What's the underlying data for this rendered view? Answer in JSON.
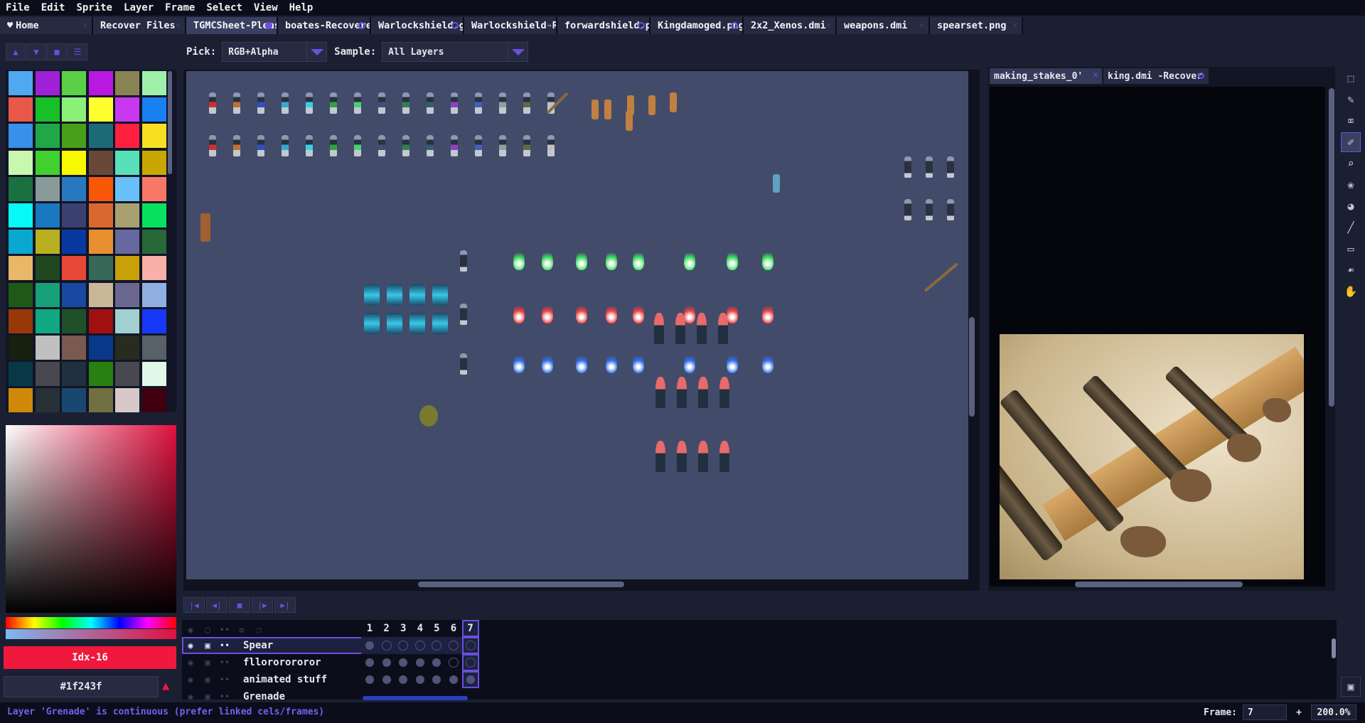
{
  "menu": [
    "File",
    "Edit",
    "Sprite",
    "Layer",
    "Frame",
    "Select",
    "View",
    "Help"
  ],
  "tabs": [
    {
      "label": "Home",
      "state": "close"
    },
    {
      "label": "Recover Files",
      "state": "close"
    },
    {
      "label": "TGMCSheet-Pleas",
      "state": "modified-active"
    },
    {
      "label": "boates-Recoverec",
      "state": "modified"
    },
    {
      "label": "Warlockshield.gif",
      "state": "modified"
    },
    {
      "label": "Warlockshield-Re",
      "state": "close"
    },
    {
      "label": "forwardshield.pn",
      "state": "modified"
    },
    {
      "label": "Kingdamoged.png",
      "state": "modified"
    },
    {
      "label": "2x2_Xenos.dmi",
      "state": "close"
    },
    {
      "label": "weapons.dmi",
      "state": "close"
    },
    {
      "label": "spearset.png",
      "state": "close"
    }
  ],
  "toolbar": {
    "pick_label": "Pick:",
    "pick_value": "RGB+Alpha",
    "sample_label": "Sample:",
    "sample_value": "All Layers"
  },
  "palette": {
    "colors": [
      "#4fa8f0",
      "#a020d8",
      "#5ad048",
      "#b818e0",
      "#8a8454",
      "#9ff0a8",
      "#e85848",
      "#18c028",
      "#8af078",
      "#ffff30",
      "#c838f0",
      "#1880f0",
      "#3890e8",
      "#20a848",
      "#48a018",
      "#1c6a78",
      "#ff2040",
      "#f8e020",
      "#c8f8b0",
      "#40d030",
      "#f8f800",
      "#6a4838",
      "#58e0b8",
      "#c8a800",
      "#1a7040",
      "#8a9a98",
      "#2878c0",
      "#f85808",
      "#68c0f8",
      "#f87868",
      "#08f8f8",
      "#1878c0",
      "#3a4070",
      "#d86830",
      "#a8a070",
      "#08e060",
      "#08a8d0",
      "#b8b020",
      "#0838a0",
      "#e89030",
      "#6868a0",
      "#286838",
      "#e8b868",
      "#204820",
      "#e84838",
      "#386858",
      "#c8a008",
      "#f8b0a8",
      "#205818",
      "#18a078",
      "#1848a0",
      "#c8b898",
      "#6a6890",
      "#90b0e0",
      "#983808",
      "#10a880",
      "#205028",
      "#a01010",
      "#a0d0d0",
      "#1838f8",
      "#182010",
      "#c0c0c0",
      "#7a5a50",
      "#083888",
      "#282c20",
      "#586068",
      "#083848",
      "#484850",
      "#203040",
      "#288010",
      "#484850",
      "#e0f8e8",
      "#d08808",
      "#283038",
      "#184870",
      "#707040",
      "#d8c8c8",
      "#400010"
    ]
  },
  "color": {
    "index_label": "Idx-16",
    "hex_value": "#1f243f",
    "picker_color": "#e0103e"
  },
  "reference_tabs": [
    {
      "label": "making_stakes_0'",
      "state": "close-active"
    },
    {
      "label": "king.dmi -Recover",
      "state": "modified"
    }
  ],
  "tools": [
    "rectangular-marquee-icon",
    "pencil-icon",
    "eraser-icon",
    "eyedropper-icon",
    "zoom-icon",
    "spray-icon",
    "paint-bucket-icon",
    "line-icon",
    "rectangle-icon",
    "blur-icon",
    "jumble-icon"
  ],
  "timeline": {
    "frames": [
      "1",
      "2",
      "3",
      "4",
      "5",
      "6",
      "7"
    ],
    "selected_frame": "7",
    "layers": [
      {
        "name": "Spear",
        "selected": true,
        "cels": [
          "full",
          "empty",
          "empty",
          "empty",
          "empty",
          "empty",
          "empty"
        ]
      },
      {
        "name": "fllororororor",
        "selected": false,
        "cels": [
          "full",
          "full",
          "full",
          "full",
          "full",
          "empty",
          "empty"
        ]
      },
      {
        "name": "animated stuff",
        "selected": false,
        "cels": [
          "full",
          "full",
          "full",
          "full",
          "full",
          "full",
          "full"
        ]
      },
      {
        "name": "Grenade",
        "selected": false,
        "cels": [
          "continuous"
        ]
      }
    ]
  },
  "status": {
    "message": "Layer 'Grenade' is continuous (prefer linked cels/frames)",
    "frame_label": "Frame:",
    "frame_value": "7",
    "plus_label": "+",
    "zoom_value": "200.0%"
  }
}
